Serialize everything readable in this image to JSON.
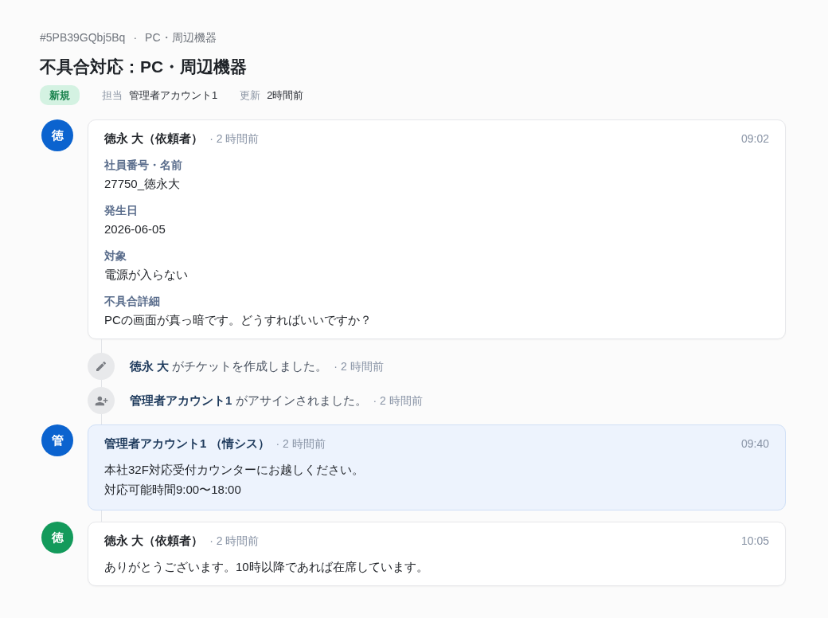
{
  "breadcrumb": {
    "ticket_id": "#5PB39GQbj5Bq",
    "separator": "·",
    "category": "PC・周辺機器"
  },
  "title": "不具合対応：PC・周辺機器",
  "status_badge": {
    "label": "新規"
  },
  "meta": [
    {
      "label": "担当",
      "value": "管理者アカウント1"
    },
    {
      "label": "更新",
      "value": "2時間前"
    }
  ],
  "timeline": [
    {
      "kind": "message",
      "avatar": "徳",
      "color": "#0b63cf",
      "author": "徳永 大（依頼者）",
      "ago": "· 2 時間前",
      "time": "09:02",
      "highlighted": false,
      "fields": [
        {
          "label": "社員番号・名前",
          "value": "27750_徳永大"
        },
        {
          "label": "発生日",
          "value": "2026-06-05"
        },
        {
          "label": "対象",
          "value": "電源が入らない"
        },
        {
          "label": "不具合詳細",
          "value": "PCの画面が真っ暗です。どうすればいいですか？"
        }
      ]
    },
    {
      "kind": "created",
      "text": "**徳永 大** がチケットを作成しました。",
      "ago": "· 2 時間前"
    },
    {
      "kind": "assigned",
      "text": "**管理者アカウント1** がアサインされました。",
      "ago": "· 2 時間前"
    },
    {
      "kind": "message",
      "avatar": "管",
      "color": "#0b63cf",
      "author": "管理者アカウント1 （情シス）",
      "ago": "· 2 時間前",
      "time": "09:40",
      "highlighted": true,
      "body": [
        "本社32F対応受付カウンターにお越しください。",
        "対応可能時間9:00〜18:00"
      ]
    },
    {
      "kind": "message",
      "avatar": "徳",
      "color": "#139a5b",
      "author": "徳永 大（依頼者）",
      "ago": "· 2 時間前",
      "time": "10:05",
      "highlighted": false,
      "body": [
        "ありがとうございます。10時以降であれば在席しています。"
      ]
    }
  ]
}
